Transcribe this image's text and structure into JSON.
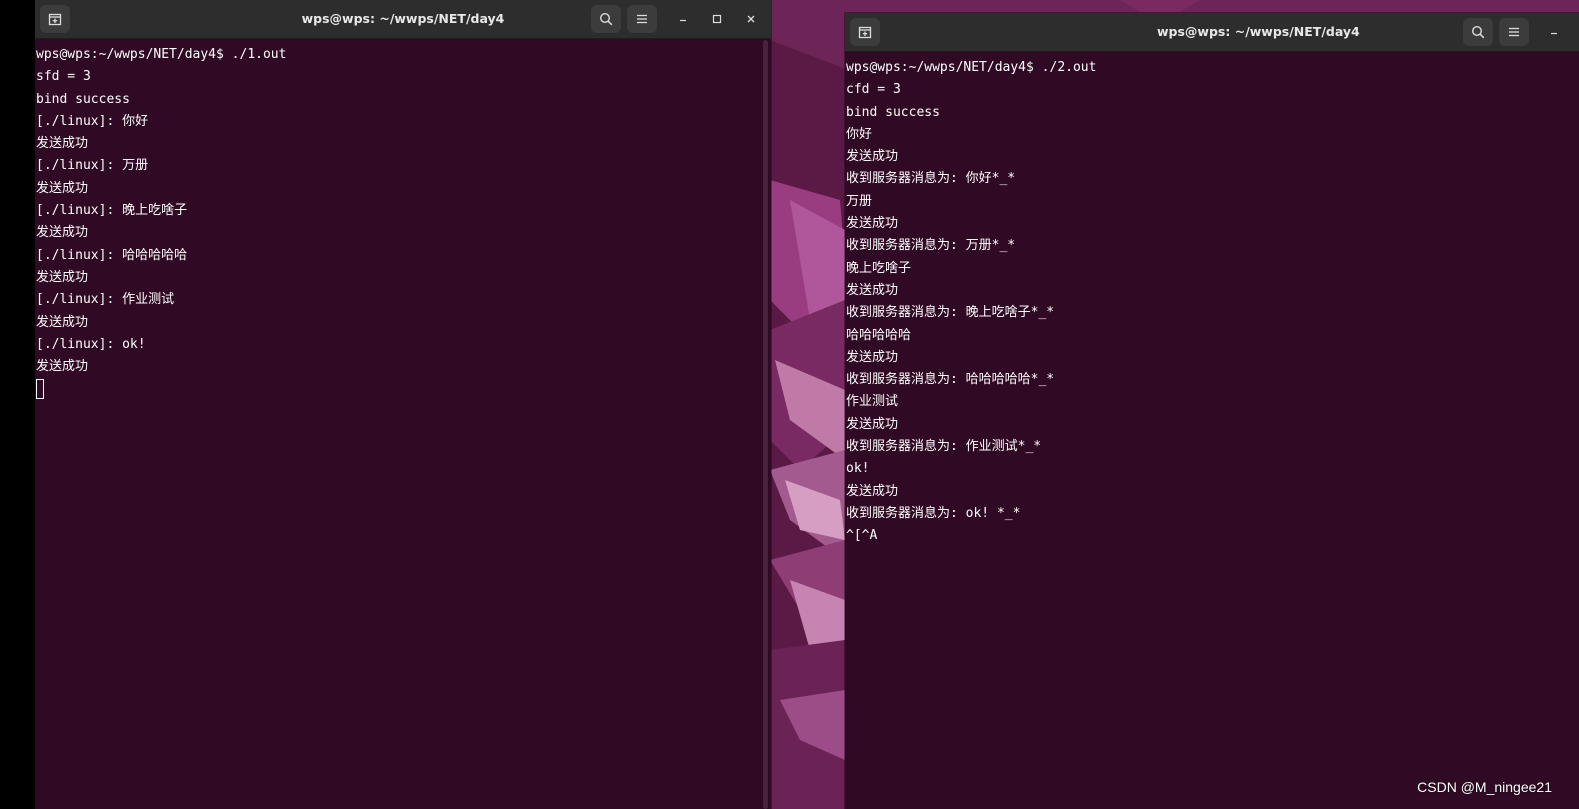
{
  "desktop": {
    "watermark": "CSDN @M_ningee21"
  },
  "left_terminal": {
    "title": "wps@wps: ~/wwps/NET/day4",
    "lines": [
      "wps@wps:~/wwps/NET/day4$ ./1.out",
      "sfd = 3",
      "bind success",
      "[./linux]: 你好",
      "发送成功",
      "[./linux]: 万册",
      "发送成功",
      "[./linux]: 晚上吃啥子",
      "发送成功",
      "[./linux]: 哈哈哈哈哈",
      "发送成功",
      "[./linux]: 作业测试",
      "发送成功",
      "[./linux]: ok!",
      "发送成功"
    ]
  },
  "right_terminal": {
    "title": "wps@wps: ~/wwps/NET/day4",
    "lines": [
      "wps@wps:~/wwps/NET/day4$ ./2.out",
      "cfd = 3",
      "bind success",
      "你好",
      "发送成功",
      "收到服务器消息为: 你好*_*",
      "万册",
      "发送成功",
      "收到服务器消息为: 万册*_*",
      "晚上吃啥子",
      "发送成功",
      "收到服务器消息为: 晚上吃啥子*_*",
      "哈哈哈哈哈",
      "发送成功",
      "收到服务器消息为: 哈哈哈哈哈*_*",
      "作业测试",
      "发送成功",
      "收到服务器消息为: 作业测试*_*",
      "ok!",
      "发送成功",
      "收到服务器消息为: ok! *_*",
      "^[^A"
    ]
  },
  "icons": {
    "new_tab": "new-tab-icon",
    "search": "search-icon",
    "menu": "hamburger-menu-icon",
    "minimize": "minimize-icon",
    "maximize": "maximize-icon",
    "close": "close-icon"
  },
  "colors": {
    "terminal_bg": "#300a24",
    "titlebar_bg": "#2d2d2d",
    "terminal_text": "#ffffff",
    "desktop_bg": "#5e1f4a"
  }
}
